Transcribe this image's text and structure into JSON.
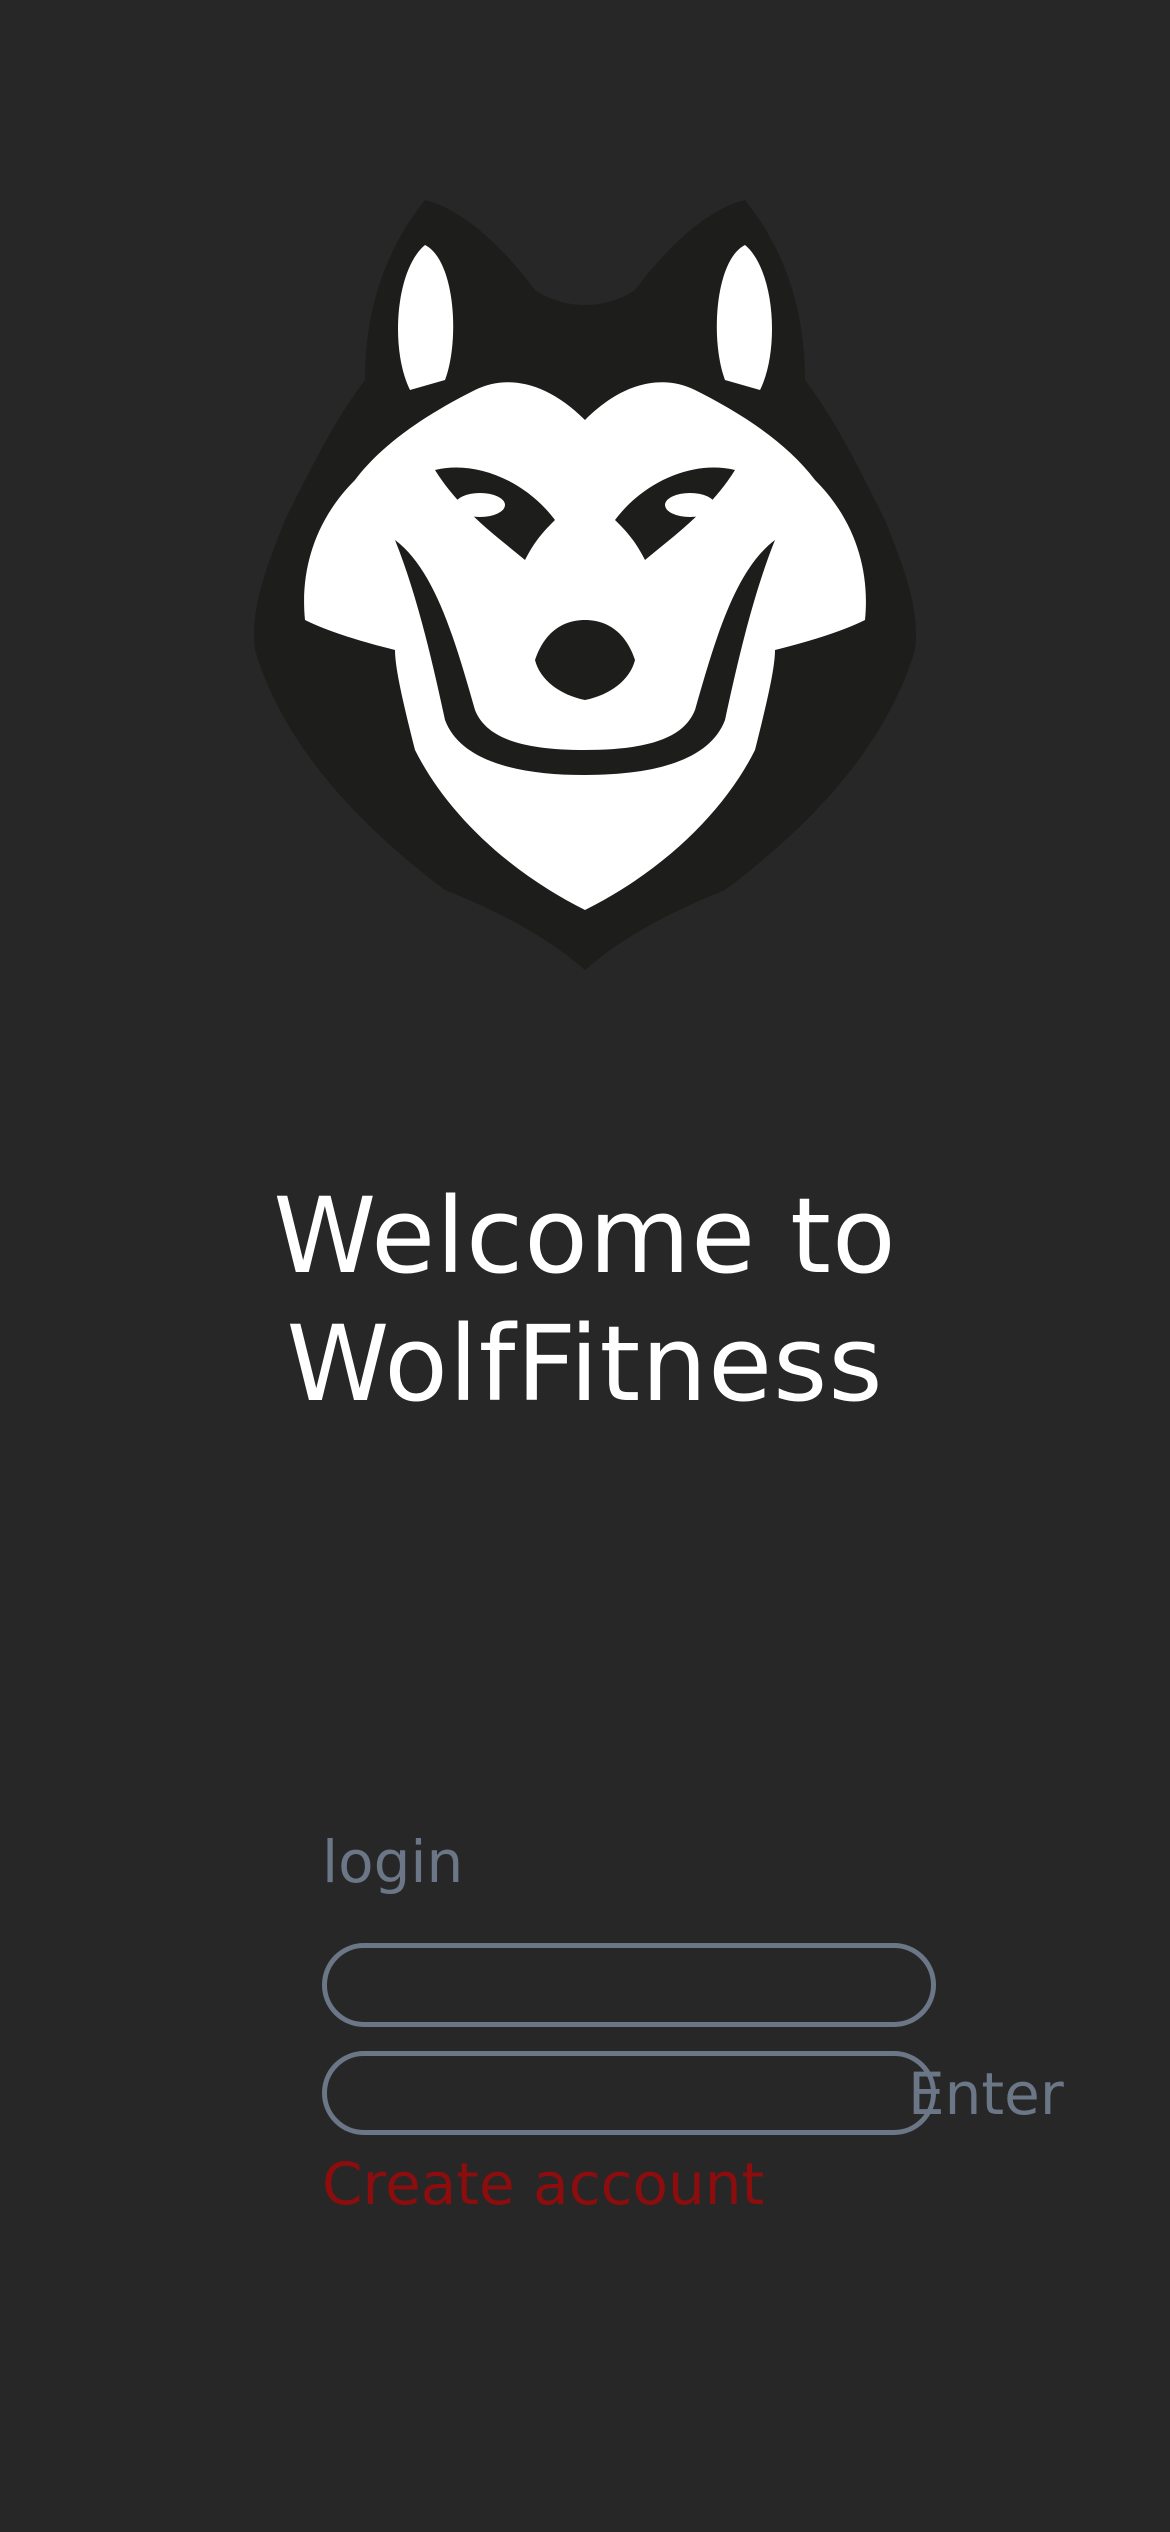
{
  "logo": {
    "icon": "wolf-head-icon",
    "colors": {
      "outer": "#1d1d1b",
      "face": "#ffffff"
    }
  },
  "welcome": {
    "line1": "Welcome to",
    "line2": "WolfFitness"
  },
  "login_form": {
    "label": "login",
    "login_value": "",
    "password_value": "",
    "enter_label": "Enter",
    "create_account_label": "Create account"
  },
  "colors": {
    "background": "#272727",
    "muted": "#6b7786",
    "accent": "#8b0d0d",
    "text": "#ffffff"
  }
}
